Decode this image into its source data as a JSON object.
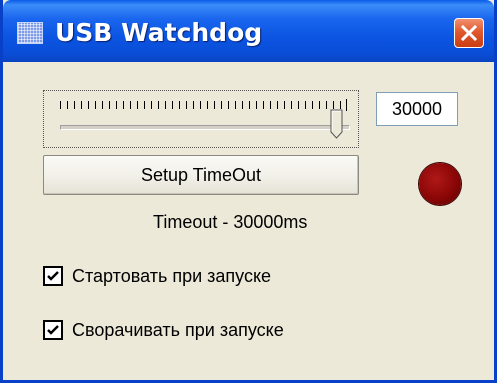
{
  "window": {
    "title": "USB Watchdog"
  },
  "timeout_value": "30000",
  "slider": {
    "level": 1.0
  },
  "setup_button_label": "Setup TimeOut",
  "status": {
    "text": "Timeout - 30000ms",
    "led_color": "#8a0606"
  },
  "options": [
    {
      "label": "Стартовать при запуске",
      "checked": true
    },
    {
      "label": "Сворачивать при запуске",
      "checked": true
    }
  ],
  "colors": {
    "titlebar": "#0a5ce8",
    "close_button": "#e05a2e",
    "window_bg": "#ece9d8"
  },
  "icons": {
    "app": "app-window-icon",
    "close": "close-icon",
    "check": "checkmark-icon"
  }
}
